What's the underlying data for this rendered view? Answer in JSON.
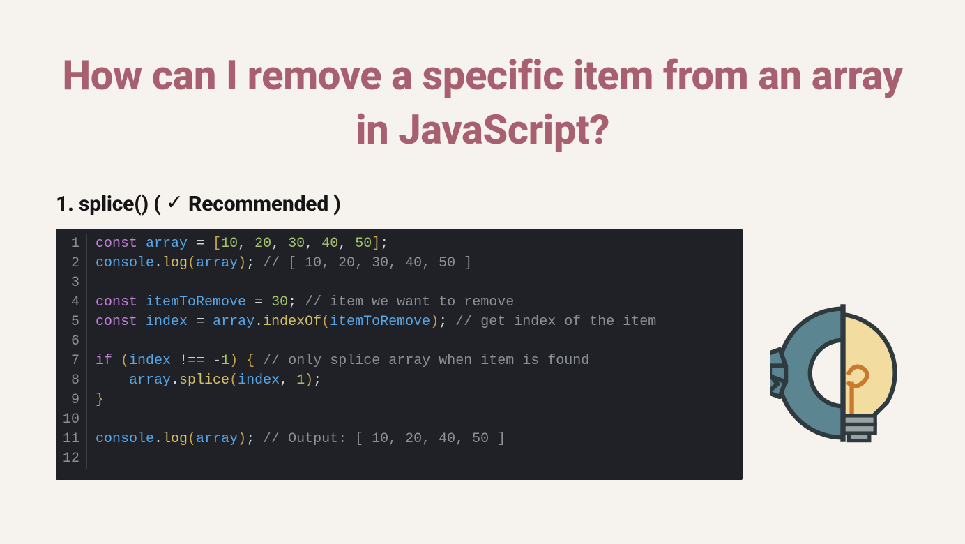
{
  "title": "How can I remove a specific item from an array in JavaScript?",
  "sub_prefix": "1. splice() ( ",
  "sub_check": "✓",
  "sub_rec": " Recommended )",
  "code_lines": [
    {
      "n": "1",
      "tokens": [
        [
          "kw",
          "const"
        ],
        [
          "sp",
          " "
        ],
        [
          "var",
          "array"
        ],
        [
          "sp",
          " "
        ],
        [
          "op",
          "="
        ],
        [
          "sp",
          " "
        ],
        [
          "brack",
          "["
        ],
        [
          "num",
          "10"
        ],
        [
          "punc",
          ", "
        ],
        [
          "num",
          "20"
        ],
        [
          "punc",
          ", "
        ],
        [
          "num",
          "30"
        ],
        [
          "punc",
          ", "
        ],
        [
          "num",
          "40"
        ],
        [
          "punc",
          ", "
        ],
        [
          "num",
          "50"
        ],
        [
          "brack",
          "]"
        ],
        [
          "punc",
          ";"
        ]
      ]
    },
    {
      "n": "2",
      "tokens": [
        [
          "var",
          "console"
        ],
        [
          "punc",
          "."
        ],
        [
          "fn",
          "log"
        ],
        [
          "paren",
          "("
        ],
        [
          "var",
          "array"
        ],
        [
          "paren",
          ")"
        ],
        [
          "punc",
          ";"
        ],
        [
          "sp",
          " "
        ],
        [
          "cmt",
          "// [ 10, 20, 30, 40, 50 ]"
        ]
      ]
    },
    {
      "n": "3",
      "tokens": []
    },
    {
      "n": "4",
      "tokens": [
        [
          "kw",
          "const"
        ],
        [
          "sp",
          " "
        ],
        [
          "var",
          "itemToRemove"
        ],
        [
          "sp",
          " "
        ],
        [
          "op",
          "="
        ],
        [
          "sp",
          " "
        ],
        [
          "num",
          "30"
        ],
        [
          "punc",
          ";"
        ],
        [
          "sp",
          " "
        ],
        [
          "cmt",
          "// item we want to remove"
        ]
      ]
    },
    {
      "n": "5",
      "tokens": [
        [
          "kw",
          "const"
        ],
        [
          "sp",
          " "
        ],
        [
          "var",
          "index"
        ],
        [
          "sp",
          " "
        ],
        [
          "op",
          "="
        ],
        [
          "sp",
          " "
        ],
        [
          "var",
          "array"
        ],
        [
          "punc",
          "."
        ],
        [
          "fn",
          "indexOf"
        ],
        [
          "paren",
          "("
        ],
        [
          "var",
          "itemToRemove"
        ],
        [
          "paren",
          ")"
        ],
        [
          "punc",
          ";"
        ],
        [
          "sp",
          " "
        ],
        [
          "cmt",
          "// get index of the item"
        ]
      ]
    },
    {
      "n": "6",
      "tokens": []
    },
    {
      "n": "7",
      "tokens": [
        [
          "kw",
          "if"
        ],
        [
          "sp",
          " "
        ],
        [
          "paren",
          "("
        ],
        [
          "var",
          "index"
        ],
        [
          "sp",
          " "
        ],
        [
          "op",
          "!=="
        ],
        [
          "sp",
          " "
        ],
        [
          "op",
          "-"
        ],
        [
          "num",
          "1"
        ],
        [
          "paren",
          ")"
        ],
        [
          "sp",
          " "
        ],
        [
          "brace",
          "{"
        ],
        [
          "sp",
          " "
        ],
        [
          "cmt",
          "// only splice array when item is found"
        ]
      ]
    },
    {
      "n": "8",
      "tokens": [
        [
          "sp",
          "    "
        ],
        [
          "var",
          "array"
        ],
        [
          "punc",
          "."
        ],
        [
          "fn",
          "splice"
        ],
        [
          "paren",
          "("
        ],
        [
          "var",
          "index"
        ],
        [
          "punc",
          ", "
        ],
        [
          "num",
          "1"
        ],
        [
          "paren",
          ")"
        ],
        [
          "punc",
          ";"
        ]
      ]
    },
    {
      "n": "9",
      "tokens": [
        [
          "brace",
          "}"
        ]
      ]
    },
    {
      "n": "10",
      "tokens": []
    },
    {
      "n": "11",
      "tokens": [
        [
          "var",
          "console"
        ],
        [
          "punc",
          "."
        ],
        [
          "fn",
          "log"
        ],
        [
          "paren",
          "("
        ],
        [
          "var",
          "array"
        ],
        [
          "paren",
          ")"
        ],
        [
          "punc",
          ";"
        ],
        [
          "sp",
          " "
        ],
        [
          "cmt",
          "// Output: [ 10, 20, 40, 50 ]"
        ]
      ]
    },
    {
      "n": "12",
      "tokens": []
    }
  ]
}
